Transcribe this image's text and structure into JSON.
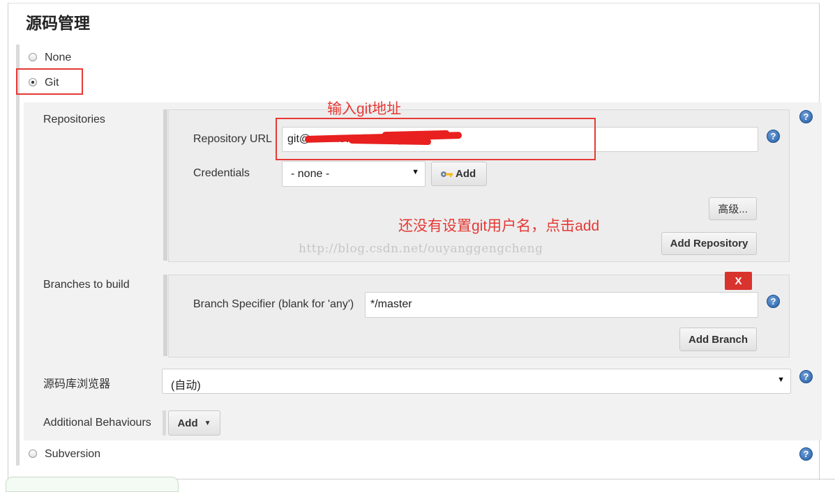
{
  "section": {
    "title": "源码管理"
  },
  "scm_options": [
    {
      "label": "None",
      "checked": false
    },
    {
      "label": "Git",
      "checked": true
    },
    {
      "label": "Subversion",
      "checked": false
    }
  ],
  "git": {
    "repositories_label": "Repositories",
    "repository_url_label": "Repository URL",
    "repository_url_value": "git@...ramework8868.git",
    "credentials_label": "Credentials",
    "credentials_value": "- none -",
    "credentials_add_label": "Add",
    "advanced_label": "高级...",
    "add_repository_label": "Add Repository",
    "branches_label": "Branches to build",
    "delete_branch_label": "X",
    "branch_specifier_label": "Branch Specifier (blank for 'any')",
    "branch_specifier_value": "*/master",
    "add_branch_label": "Add Branch",
    "browser_label": "源码库浏览器",
    "browser_value": "(自动)",
    "additional_behaviours_label": "Additional Behaviours",
    "additional_behaviours_add_label": "Add"
  },
  "annotations": {
    "url_note": "输入git地址",
    "credentials_note": "还没有设置git用户名，点击add"
  },
  "watermark": "http://blog.csdn.net/ouyanggengcheng",
  "icons": {
    "help": "help-icon",
    "key": "key-icon",
    "dropdown": "caret-down-icon"
  },
  "colors": {
    "annotation_red": "#e53935",
    "delete_button_red": "#d9332e",
    "help_blue": "#245ea6",
    "panel_grey": "#f2f2f2"
  }
}
